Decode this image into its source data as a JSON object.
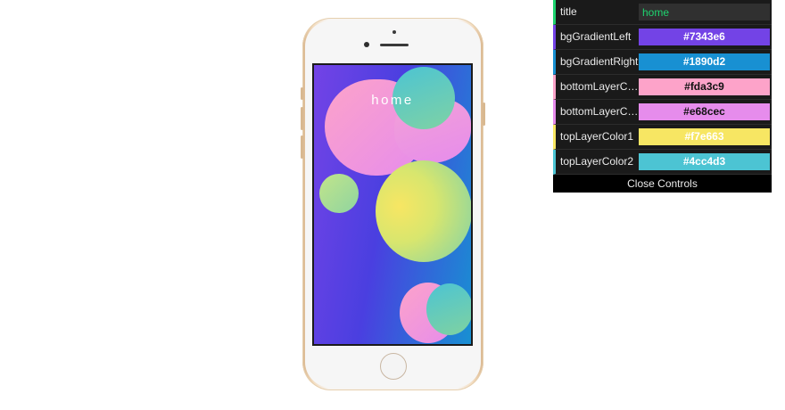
{
  "screen": {
    "title": "home"
  },
  "controls": {
    "title_field": {
      "label": "title",
      "value": "home"
    },
    "colors": [
      {
        "label": "bgGradientLeft",
        "value": "#7343e6",
        "bg": "#7343e6",
        "border": "#7343e6",
        "text_color": "#ffffff"
      },
      {
        "label": "bgGradientRight",
        "value": "#1890d2",
        "bg": "#1890d2",
        "border": "#1890d2",
        "text_color": "#ffffff"
      },
      {
        "label": "bottomLayerCo…",
        "value": "#fda3c9",
        "bg": "#fda3c9",
        "border": "#fda3c9",
        "text_color": "#111111"
      },
      {
        "label": "bottomLayerCo…",
        "value": "#e68cec",
        "bg": "#e68cec",
        "border": "#e68cec",
        "text_color": "#111111"
      },
      {
        "label": "topLayerColor1",
        "value": "#f7e663",
        "bg": "#f7e663",
        "border": "#f7e663",
        "text_color": "#ffffff"
      },
      {
        "label": "topLayerColor2",
        "value": "#4cc4d3",
        "bg": "#4cc4d3",
        "border": "#4cc4d3",
        "text_color": "#ffffff"
      }
    ],
    "close_label": "Close Controls"
  }
}
